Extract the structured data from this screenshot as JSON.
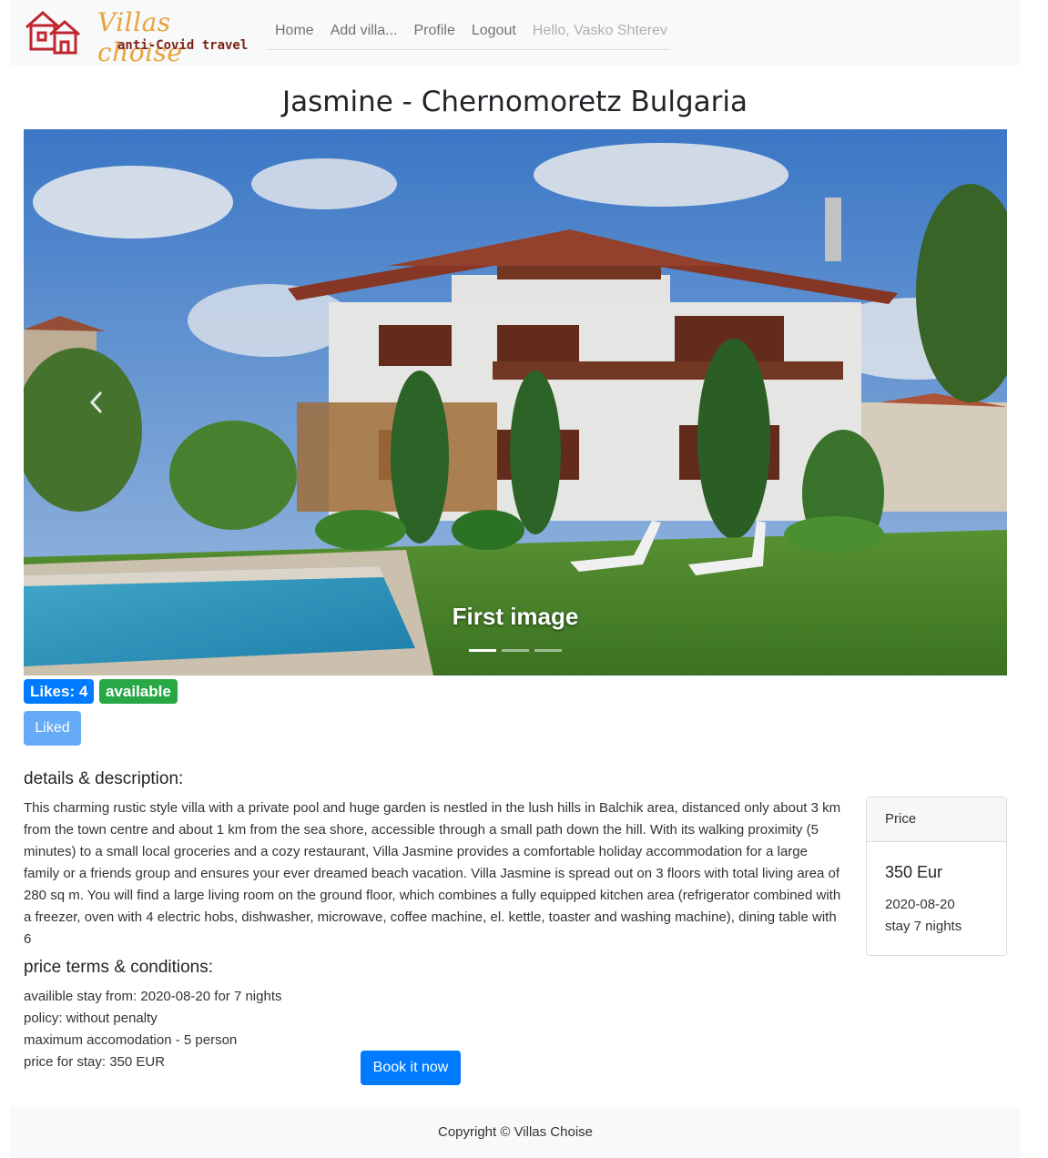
{
  "brand": {
    "name": "Villas choise",
    "tagline": "anti-Covid travel",
    "logo_icon": "house-icon",
    "logo_color": "#c0262d"
  },
  "nav": {
    "home": "Home",
    "add_villa": "Add villa...",
    "profile": "Profile",
    "logout": "Logout",
    "greeting": "Hello, Vasko Shterev"
  },
  "villa": {
    "title": "Jasmine - Chernomoretz Bulgaria",
    "likes_badge": "Likes: 4",
    "status_badge": "available",
    "liked_button": "Liked"
  },
  "carousel": {
    "caption": "First image",
    "prev_icon": "chevron-left-icon",
    "indicator_count": 3,
    "active_index": 0
  },
  "details": {
    "heading": "details & description:",
    "text": "This charming rustic style villa with a private pool and huge garden is nestled in the lush hills in Balchik area, distanced only about 3 km from the town centre and about 1 km from the sea shore, accessible through a small path down the hill. With its walking proximity (5 minutes) to a small local groceries and a cozy restaurant, Villa Jasmine provides a comfortable holiday accommodation for a large family or a friends group and ensures your ever dreamed beach vacation. Villa Jasmine is spread out on 3 floors with total living area of 280 sq m. You will find a large living room on the ground floor, which combines a fully equipped kitchen area (refrigerator combined with a freezer, oven with 4 electric hobs, dishwasher, microwave, coffee machine, el. kettle, toaster and washing machine), dining table with 6"
  },
  "terms": {
    "heading": "price terms & conditions:",
    "lines": [
      "availible stay from: 2020-08-20 for 7 nights",
      "policy: without penalty",
      "maximum accomodation - 5 person",
      "price for stay: 350 EUR"
    ],
    "book_button": "Book it now"
  },
  "price_card": {
    "header": "Price",
    "amount": "350 Eur",
    "date": "2020-08-20",
    "stay": "stay 7 nights"
  },
  "footer": {
    "copyright": "Copyright © Villas Choise"
  },
  "colors": {
    "primary": "#007bff",
    "success": "#28a745",
    "liked": "#66abf7",
    "navbar_bg": "#f8f9fa"
  }
}
